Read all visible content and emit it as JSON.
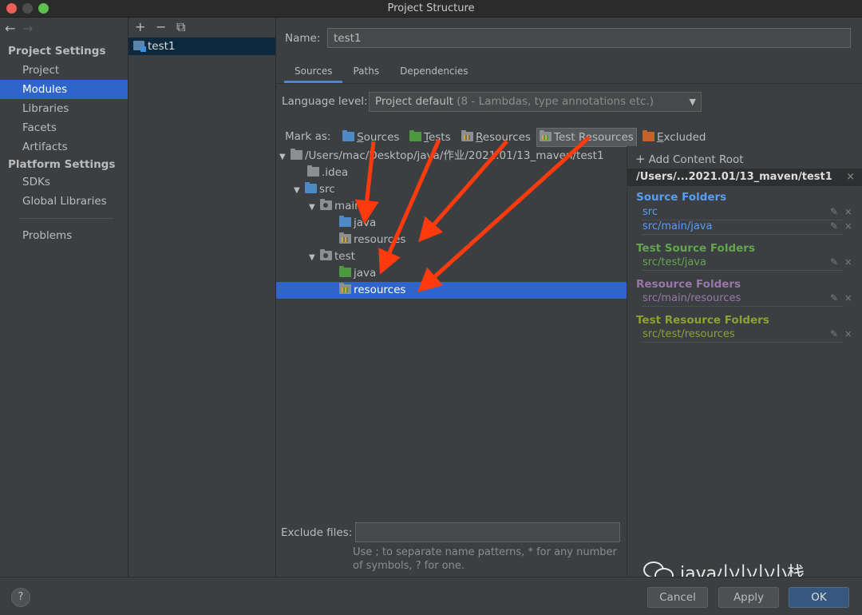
{
  "window": {
    "title": "Project Structure"
  },
  "nav": {
    "back": "←",
    "forward": "→",
    "project_settings": "Project Settings",
    "items_a": [
      "Project",
      "Modules",
      "Libraries",
      "Facets",
      "Artifacts"
    ],
    "platform_settings": "Platform Settings",
    "items_b": [
      "SDKs",
      "Global Libraries"
    ],
    "problems": "Problems",
    "selected": "Modules"
  },
  "modules": {
    "tools": [
      "+",
      "−",
      "⧉"
    ],
    "items": [
      "test1"
    ]
  },
  "main": {
    "name_label": "Name:",
    "name_value": "test1",
    "tabs": [
      "Sources",
      "Paths",
      "Dependencies"
    ],
    "active_tab": "Sources",
    "language_label": "Language level:",
    "language_value": "Project default",
    "language_hint": "(8 - Lambdas, type annotations etc.)",
    "mark_as_label": "Mark as:",
    "mark_as": [
      {
        "label": "Sources",
        "ul": "S",
        "rest": "ources"
      },
      {
        "label": "Tests",
        "ul": "T",
        "rest": "ests"
      },
      {
        "label": "Resources",
        "ul": "R",
        "rest": "esources"
      },
      {
        "label": "Test Resources",
        "ul": "",
        "rest": "Test Resources"
      },
      {
        "label": "Excluded",
        "ul": "E",
        "rest": "xcluded"
      }
    ],
    "tree": [
      {
        "label": "/Users/mac/Desktop/java/作业/2021.01/13_maven/test1",
        "icon": "grey"
      },
      {
        "label": ".idea",
        "icon": "grey"
      },
      {
        "label": "src",
        "icon": "blue"
      },
      {
        "label": "main",
        "icon": "mod"
      },
      {
        "label": "java",
        "icon": "blue"
      },
      {
        "label": "resources",
        "icon": "res"
      },
      {
        "label": "test",
        "icon": "mod"
      },
      {
        "label": "java",
        "icon": "green"
      },
      {
        "label": "resources",
        "icon": "tres"
      }
    ],
    "selected_row": 8,
    "exclude_label": "Exclude files:",
    "exclude_value": "",
    "exclude_hint": "Use ; to separate name patterns, * for any number of symbols, ? for one."
  },
  "right": {
    "add_root": "Add Content Root",
    "root_path": "/Users/...2021.01/13_maven/test1",
    "close_glyph": "×",
    "edit_glyph": "✎",
    "groups": [
      {
        "title": "Source Folders",
        "paths": [
          "src",
          "src/main/java"
        ],
        "color": "#589df6"
      },
      {
        "title": "Test Source Folders",
        "paths": [
          "src/test/java"
        ],
        "color": "#62a54f"
      },
      {
        "title": "Resource Folders",
        "paths": [
          "src/main/resources"
        ],
        "color": "#9876aa"
      },
      {
        "title": "Test Resource Folders",
        "paths": [
          "src/test/resources"
        ],
        "color": "#8fa02f"
      }
    ]
  },
  "bottom": {
    "help": "?",
    "cancel": "Cancel",
    "apply": "Apply",
    "ok": "OK"
  },
  "watermark": {
    "text": "java小小小小栈"
  },
  "colors": {
    "accent": "#2f65ca",
    "arrow": "#ff3b0d",
    "ok_button": "#365880"
  }
}
